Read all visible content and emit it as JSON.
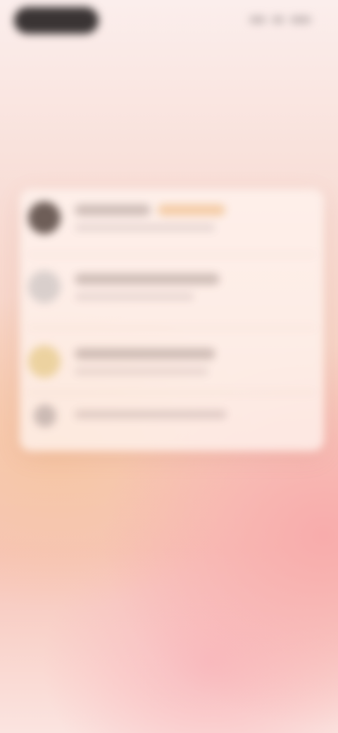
{
  "colors": {
    "status_pill": "#3a3434",
    "card_background": "#fff4ee",
    "accent_warm": "#f0c090",
    "icon_dark": "#6e5e58",
    "icon_light": "#d9cfcc",
    "icon_gold": "#ecd2a0",
    "icon_muted": "#cbbab4",
    "background_pink": "#f8acac",
    "background_peach": "#f6c6a4"
  },
  "status_bar": {
    "left_icon": "status-pill",
    "right_icons": [
      "signal-icon",
      "wifi-icon",
      "battery-icon"
    ]
  },
  "list": {
    "items": [
      {
        "icon": "avatar-icon",
        "has_badge": true
      },
      {
        "icon": "circle-icon",
        "has_badge": false
      },
      {
        "icon": "star-icon",
        "has_badge": false
      },
      {
        "icon": "settings-icon",
        "has_badge": false
      }
    ]
  }
}
